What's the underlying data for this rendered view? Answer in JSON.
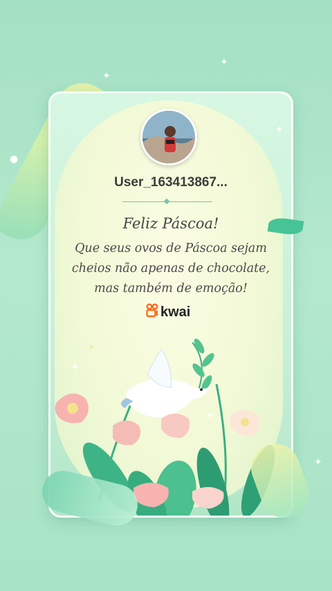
{
  "user": {
    "name": "User_163413867..."
  },
  "greeting": {
    "title": "Feliz Páscoa!",
    "lines": [
      "Que seus ovos de Páscoa sejam",
      "cheios não apenas de chocolate,",
      "mas também de emoção!"
    ]
  },
  "brand": {
    "label": "kwai",
    "color": "#ff6a1f"
  },
  "colors": {
    "accent": "#47c496",
    "background": "#a8e3c6"
  },
  "icons": {
    "brand_logo": "kwai-logo-icon",
    "bird": "dove-icon"
  }
}
